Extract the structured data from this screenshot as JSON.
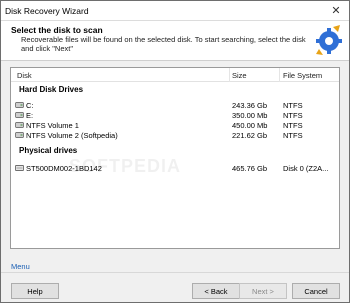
{
  "window": {
    "title": "Disk Recovery Wizard",
    "close_glyph": "✕"
  },
  "header": {
    "title": "Select the disk to scan",
    "description": "Recoverable files will be found on the selected disk. To start searching, select the disk and click \"Next\""
  },
  "list": {
    "columns": {
      "disk": "Disk",
      "size": "Size",
      "file_system": "File System"
    },
    "groups": [
      {
        "title": "Hard Disk Drives",
        "rows": [
          {
            "name": "C:",
            "size": "243.36 Gb",
            "fs": "NTFS"
          },
          {
            "name": "E:",
            "size": "350.00 Mb",
            "fs": "NTFS"
          },
          {
            "name": "NTFS Volume 1",
            "size": "450.00 Mb",
            "fs": "NTFS"
          },
          {
            "name": "NTFS Volume 2 (Softpedia)",
            "size": "221.62 Gb",
            "fs": "NTFS"
          }
        ]
      },
      {
        "title": "Physical drives",
        "rows": [
          {
            "name": "ST500DM002-1BD142",
            "size": "465.76 Gb",
            "fs": "Disk 0 (Z2A..."
          }
        ]
      }
    ],
    "watermark": "SOFTPEDIA"
  },
  "menu_label": "Menu",
  "buttons": {
    "help": "Help",
    "back": "< Back",
    "next": "Next >",
    "cancel": "Cancel"
  },
  "colors": {
    "link": "#1a5fb4",
    "logo_gear": "#2f6fd6",
    "logo_accent": "#e8a317"
  }
}
